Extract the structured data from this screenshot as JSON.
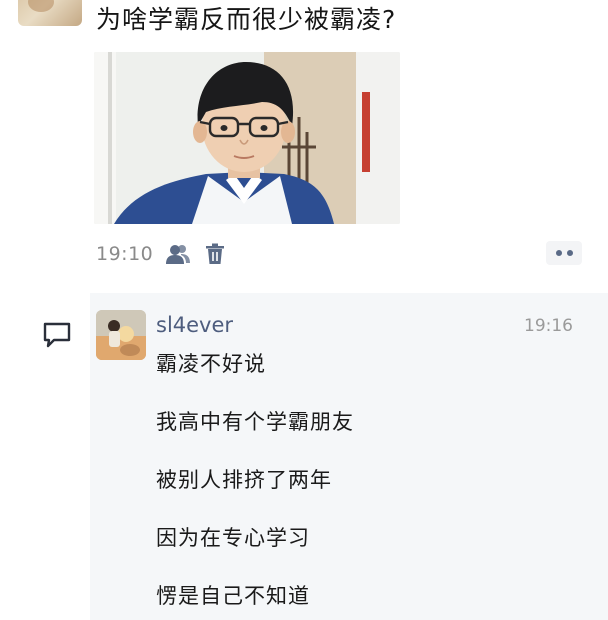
{
  "post": {
    "text": "为啥学霸反而很少被霸凌?",
    "time": "19:10",
    "icons": {
      "visibility": "people-icon",
      "delete": "trash-icon",
      "more": "more-dots-icon"
    }
  },
  "comment": {
    "icon": "comment-bubble-icon",
    "author": "sl4ever",
    "time": "19:16",
    "lines": [
      "霸凌不好说",
      "我高中有个学霸朋友",
      "被别人排挤了两年",
      "因为在专心学习",
      "愣是自己不知道"
    ]
  },
  "colors": {
    "name_link": "#4e5d7e",
    "time_gray": "#8a8a8a",
    "panel_bg": "#f5f7f9",
    "more_dots": "#5a6a86"
  }
}
